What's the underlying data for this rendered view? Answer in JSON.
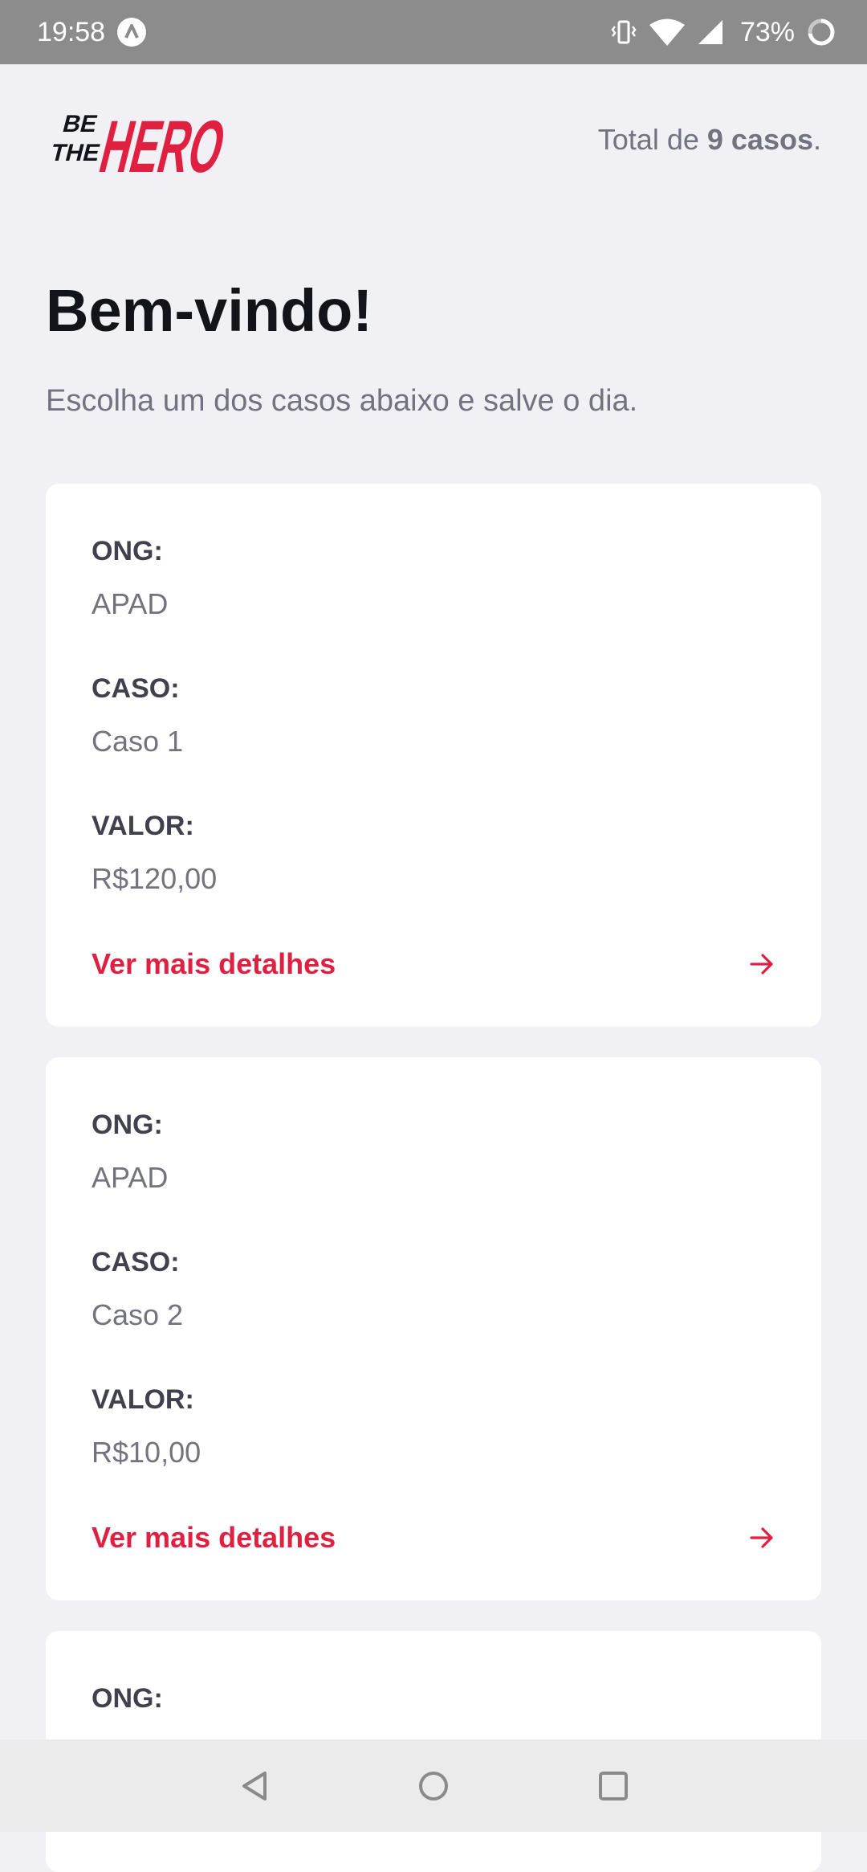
{
  "status_bar": {
    "time": "19:58",
    "battery": "73%",
    "icons": [
      "app-notification-icon",
      "vibrate-icon",
      "wifi-icon",
      "cellular-signal-icon",
      "battery-icon"
    ]
  },
  "header": {
    "logo_text": "BE THE HERO",
    "total_prefix": "Total de ",
    "total_count": "9 casos",
    "total_suffix": "."
  },
  "main": {
    "title": "Bem-vindo!",
    "description": "Escolha um dos casos abaixo e salve o dia."
  },
  "incidents": [
    {
      "ong_label": "ONG:",
      "ong": "APAD",
      "caso_label": "CASO:",
      "caso": "Caso 1",
      "valor_label": "VALOR:",
      "valor": "R$120,00",
      "details_label": "Ver mais detalhes"
    },
    {
      "ong_label": "ONG:",
      "ong": "APAD",
      "caso_label": "CASO:",
      "caso": "Caso 2",
      "valor_label": "VALOR:",
      "valor": "R$10,00",
      "details_label": "Ver mais detalhes"
    },
    {
      "ong_label": "ONG:"
    }
  ],
  "colors": {
    "background": "#f0f0f5",
    "accent": "#e02041",
    "title": "#13131a",
    "label": "#41414d",
    "text": "#737380",
    "card": "#ffffff",
    "status_bar": "#8c8c8c",
    "nav_bar": "#ebebeb"
  },
  "nav_bar": {
    "icons": [
      "back-icon",
      "home-icon",
      "recents-icon"
    ]
  }
}
